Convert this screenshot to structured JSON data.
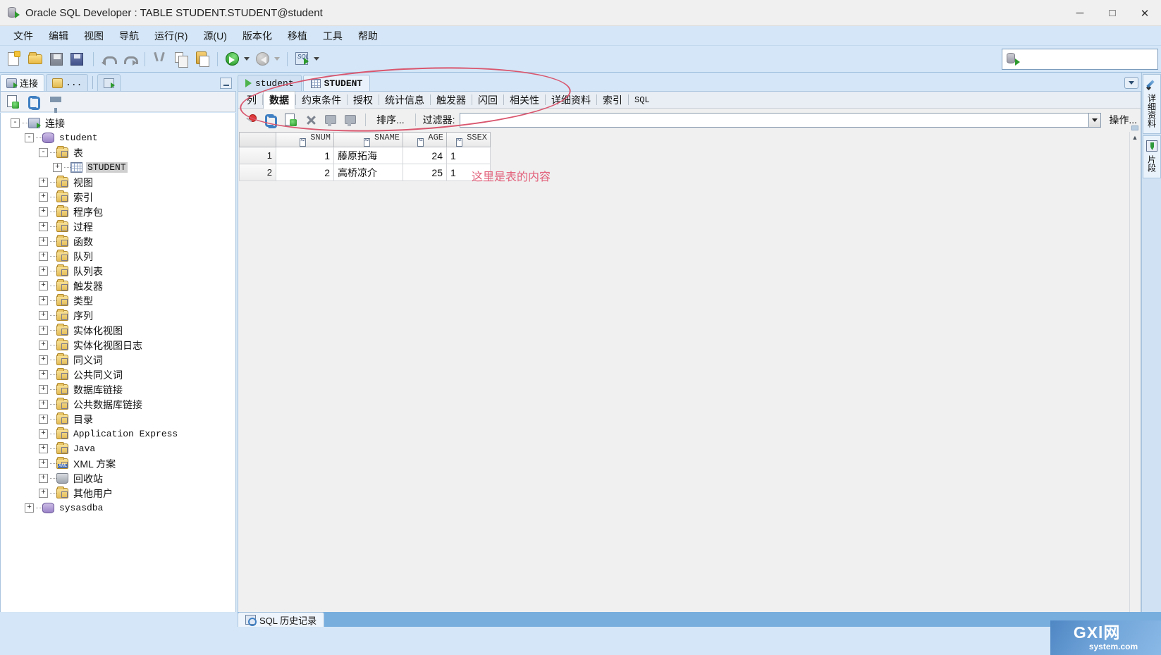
{
  "window": {
    "title": "Oracle SQL Developer : TABLE STUDENT.STUDENT@student",
    "app_icon": "database-arrow-icon",
    "minimize": "─",
    "maximize": "□",
    "close": "✕"
  },
  "menubar": {
    "items": [
      {
        "label": "文件"
      },
      {
        "label": "编辑"
      },
      {
        "label": "视图"
      },
      {
        "label": "导航"
      },
      {
        "label": "运行(R)",
        "mnemonic": "R"
      },
      {
        "label": "源(U)",
        "mnemonic": "U"
      },
      {
        "label": "版本化"
      },
      {
        "label": "移植"
      },
      {
        "label": "工具"
      },
      {
        "label": "帮助"
      }
    ]
  },
  "toolbar": {
    "buttons": [
      {
        "name": "new-button",
        "icon": "new-file-icon"
      },
      {
        "name": "open-button",
        "icon": "open-folder-icon"
      },
      {
        "name": "save-button",
        "icon": "save-icon"
      },
      {
        "name": "save-all-button",
        "icon": "save-all-icon"
      },
      {
        "name": "undo-button",
        "icon": "undo-arrow-icon"
      },
      {
        "name": "redo-button",
        "icon": "redo-arrow-icon"
      },
      {
        "name": "cut-button",
        "icon": "scissors-icon"
      },
      {
        "name": "copy-button",
        "icon": "copy-icon"
      },
      {
        "name": "paste-button",
        "icon": "clipboard-paste-icon"
      },
      {
        "name": "back-button",
        "icon": "green-back-arrow-icon"
      },
      {
        "name": "forward-button",
        "icon": "grey-forward-arrow-icon"
      },
      {
        "name": "new-sql-worksheet-button",
        "icon": "sql-worksheet-icon"
      }
    ],
    "search": {
      "value": "",
      "placeholder": "",
      "icon": "database-arrow-icon"
    }
  },
  "left_panel": {
    "tabs": [
      {
        "label": "连接",
        "icon": "connections-icon",
        "active": true
      },
      {
        "label": "...",
        "icon": "folder-icon",
        "active": false
      },
      {
        "label": "",
        "icon": "reports-icon",
        "active": false
      }
    ],
    "minimize_label": "",
    "tree_toolbar": [
      {
        "name": "new-connection-button",
        "icon": "new-connection-icon"
      },
      {
        "name": "refresh-button",
        "icon": "refresh-icon"
      },
      {
        "name": "filter-button",
        "icon": "funnel-icon"
      }
    ],
    "tree": [
      {
        "label": "连接",
        "depth": 0,
        "expander": "-",
        "icon": "connections-icon",
        "mono": false,
        "selected": false
      },
      {
        "label": "student",
        "depth": 1,
        "expander": "-",
        "icon": "database-connection-icon",
        "mono": true,
        "selected": false
      },
      {
        "label": "表",
        "depth": 2,
        "expander": "-",
        "icon": "tables-folder-icon",
        "mono": false,
        "selected": false
      },
      {
        "label": "STUDENT",
        "depth": 3,
        "expander": "+",
        "icon": "table-grid-icon",
        "mono": true,
        "selected": true
      },
      {
        "label": "视图",
        "depth": 2,
        "expander": "+",
        "icon": "views-folder-icon",
        "mono": false,
        "selected": false
      },
      {
        "label": "索引",
        "depth": 2,
        "expander": "+",
        "icon": "indexes-folder-icon",
        "mono": false,
        "selected": false
      },
      {
        "label": "程序包",
        "depth": 2,
        "expander": "+",
        "icon": "packages-folder-icon",
        "mono": false,
        "selected": false
      },
      {
        "label": "过程",
        "depth": 2,
        "expander": "+",
        "icon": "procedures-folder-icon",
        "mono": false,
        "selected": false
      },
      {
        "label": "函数",
        "depth": 2,
        "expander": "+",
        "icon": "functions-folder-icon",
        "mono": false,
        "selected": false
      },
      {
        "label": "队列",
        "depth": 2,
        "expander": "+",
        "icon": "queues-folder-icon",
        "mono": false,
        "selected": false
      },
      {
        "label": "队列表",
        "depth": 2,
        "expander": "+",
        "icon": "queue-tables-folder-icon",
        "mono": false,
        "selected": false
      },
      {
        "label": "触发器",
        "depth": 2,
        "expander": "+",
        "icon": "triggers-folder-icon",
        "mono": false,
        "selected": false
      },
      {
        "label": "类型",
        "depth": 2,
        "expander": "+",
        "icon": "types-folder-icon",
        "mono": false,
        "selected": false
      },
      {
        "label": "序列",
        "depth": 2,
        "expander": "+",
        "icon": "sequences-folder-icon",
        "mono": false,
        "selected": false
      },
      {
        "label": "实体化视图",
        "depth": 2,
        "expander": "+",
        "icon": "materialized-views-folder-icon",
        "mono": false,
        "selected": false
      },
      {
        "label": "实体化视图日志",
        "depth": 2,
        "expander": "+",
        "icon": "materialized-view-logs-folder-icon",
        "mono": false,
        "selected": false
      },
      {
        "label": "同义词",
        "depth": 2,
        "expander": "+",
        "icon": "synonyms-folder-icon",
        "mono": false,
        "selected": false
      },
      {
        "label": "公共同义词",
        "depth": 2,
        "expander": "+",
        "icon": "public-synonyms-folder-icon",
        "mono": false,
        "selected": false
      },
      {
        "label": "数据库链接",
        "depth": 2,
        "expander": "+",
        "icon": "database-links-folder-icon",
        "mono": false,
        "selected": false
      },
      {
        "label": "公共数据库链接",
        "depth": 2,
        "expander": "+",
        "icon": "public-database-links-folder-icon",
        "mono": false,
        "selected": false
      },
      {
        "label": "目录",
        "depth": 2,
        "expander": "+",
        "icon": "directories-folder-icon",
        "mono": false,
        "selected": false
      },
      {
        "label": "Application Express",
        "depth": 2,
        "expander": "+",
        "icon": "apex-folder-icon",
        "mono": true,
        "selected": false
      },
      {
        "label": "Java",
        "depth": 2,
        "expander": "+",
        "icon": "java-folder-icon",
        "mono": true,
        "selected": false
      },
      {
        "label": "XML 方案",
        "depth": 2,
        "expander": "+",
        "icon": "xml-schemas-folder-icon",
        "mono": false,
        "selected": false
      },
      {
        "label": "回收站",
        "depth": 2,
        "expander": "+",
        "icon": "recycle-bin-icon",
        "mono": false,
        "selected": false
      },
      {
        "label": "其他用户",
        "depth": 2,
        "expander": "+",
        "icon": "other-users-folder-icon",
        "mono": false,
        "selected": false
      },
      {
        "label": "sysasdba",
        "depth": 1,
        "expander": "+",
        "icon": "database-connection-icon",
        "mono": true,
        "selected": false
      }
    ]
  },
  "editor": {
    "tabs": [
      {
        "label": "student",
        "icon": "worksheet-play-icon",
        "active": false,
        "bold": false
      },
      {
        "label": "STUDENT",
        "icon": "table-grid-icon",
        "active": true,
        "bold": true
      }
    ],
    "sub_tabs": [
      {
        "label": "列",
        "active": false,
        "mono": false
      },
      {
        "label": "数据",
        "active": true,
        "mono": false
      },
      {
        "label": "约束条件",
        "active": false,
        "mono": false
      },
      {
        "label": "授权",
        "active": false,
        "mono": false
      },
      {
        "label": "统计信息",
        "active": false,
        "mono": false
      },
      {
        "label": "触发器",
        "active": false,
        "mono": false
      },
      {
        "label": "闪回",
        "active": false,
        "mono": false
      },
      {
        "label": "相关性",
        "active": false,
        "mono": false
      },
      {
        "label": "详细资料",
        "active": false,
        "mono": false
      },
      {
        "label": "索引",
        "active": false,
        "mono": false
      },
      {
        "label": "SQL",
        "active": false,
        "mono": true
      }
    ],
    "grid_toolbar": {
      "icons": [
        {
          "name": "freeze-pin-button",
          "icon": "pin-icon"
        },
        {
          "name": "refresh-data-button",
          "icon": "refresh-icon"
        },
        {
          "name": "insert-row-button",
          "icon": "insert-row-icon"
        },
        {
          "name": "delete-row-button",
          "icon": "delete-row-icon"
        },
        {
          "name": "commit-button",
          "icon": "commit-icon"
        },
        {
          "name": "rollback-button",
          "icon": "rollback-icon"
        }
      ],
      "sort_label": "排序...",
      "filter_label": "过滤器:",
      "filter_value": "",
      "filter_placeholder": "",
      "actions_label": "操作..."
    },
    "annotation": "这里是表的内容"
  },
  "grid_data": {
    "row_header": "",
    "columns": [
      "SNUM",
      "SNAME",
      "AGE",
      "SSEX"
    ],
    "column_icon": "sort-az-icon",
    "rows": [
      {
        "n": "1",
        "SNUM": "1",
        "SNAME": "藤原拓海",
        "AGE": "24",
        "SSEX": "1"
      },
      {
        "n": "2",
        "SNUM": "2",
        "SNAME": "高桥凉介",
        "AGE": "25",
        "SSEX": "1"
      }
    ]
  },
  "dock": {
    "items": [
      {
        "label": "详细资料",
        "icon": "pen-detail-icon"
      },
      {
        "label": "片段",
        "icon": "snippets-icon"
      }
    ]
  },
  "status": {
    "sql_history_tab": "SQL 历史记录",
    "sql_history_icon": "history-clock-icon"
  },
  "watermark": {
    "top": "GXl网",
    "bottom": "system.com"
  },
  "colors": {
    "accent": "#d4e6f7",
    "annotation_red": "#e2607a",
    "ellipse_red": "#d9566e",
    "selection_blue": "#78aede"
  }
}
